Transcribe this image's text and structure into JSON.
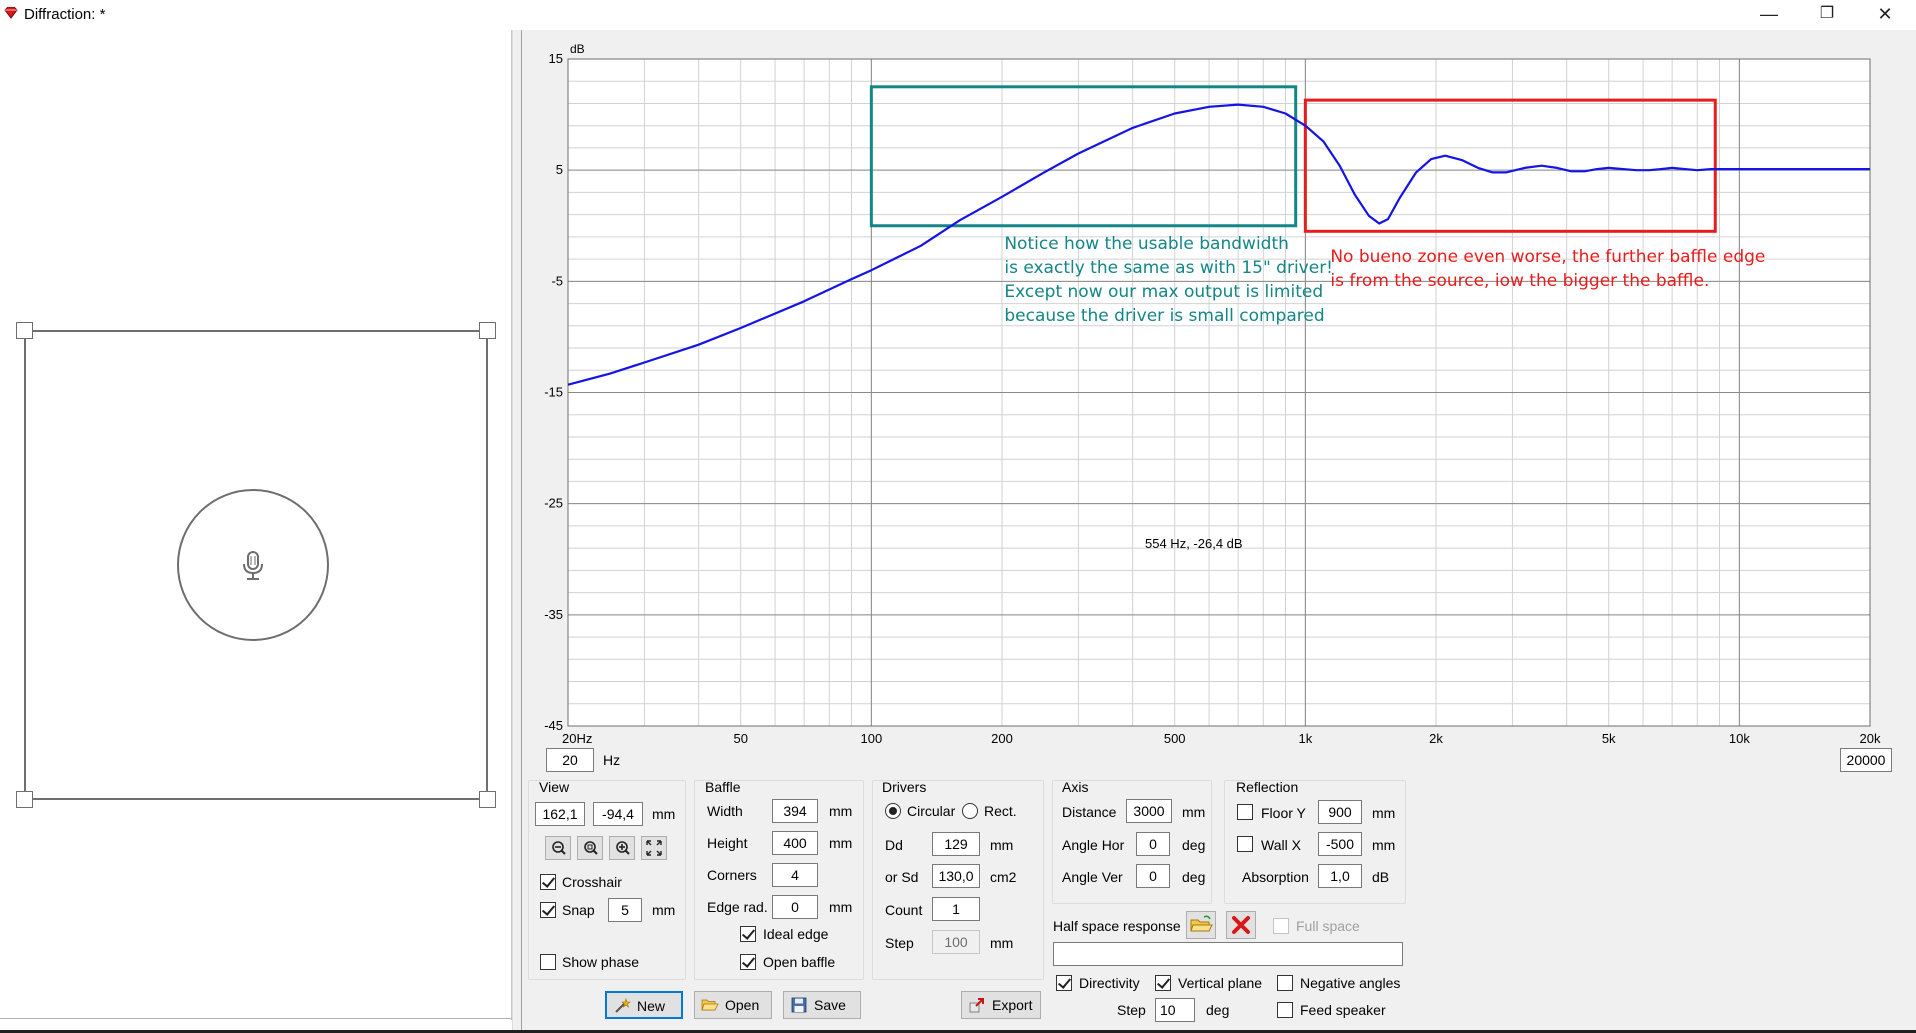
{
  "window": {
    "title": "Diffraction: *",
    "minimize_glyph": "—",
    "restore_glyph": "❐",
    "close_glyph": "✕"
  },
  "chart": {
    "freq_min_value": "20",
    "freq_min_unit": "Hz",
    "freq_max_value": "20000",
    "readout": "554 Hz, -26,4 dB"
  },
  "chart_data": {
    "type": "line",
    "xscale": "log",
    "xlim": [
      20,
      20000
    ],
    "ylim": [
      -45,
      15
    ],
    "ylabel": "dB",
    "grid": true,
    "y_ticks": [
      "15",
      "5",
      "-5",
      "-15",
      "-25",
      "-35",
      "-45"
    ],
    "x_ticks": [
      {
        "v": 20,
        "label": "20Hz"
      },
      {
        "v": 50,
        "label": "50"
      },
      {
        "v": 100,
        "label": "100"
      },
      {
        "v": 200,
        "label": "200"
      },
      {
        "v": 500,
        "label": "500"
      },
      {
        "v": 1000,
        "label": "1k"
      },
      {
        "v": 2000,
        "label": "2k"
      },
      {
        "v": 5000,
        "label": "5k"
      },
      {
        "v": 10000,
        "label": "10k"
      },
      {
        "v": 20000,
        "label": "20k"
      }
    ],
    "series": [
      {
        "color": "#1414e6",
        "points": [
          [
            20,
            -14.3
          ],
          [
            25,
            -13.3
          ],
          [
            30,
            -12.3
          ],
          [
            40,
            -10.7
          ],
          [
            50,
            -9.2
          ],
          [
            70,
            -6.8
          ],
          [
            90,
            -4.8
          ],
          [
            100,
            -4.0
          ],
          [
            130,
            -1.8
          ],
          [
            160,
            0.5
          ],
          [
            200,
            2.6
          ],
          [
            250,
            4.8
          ],
          [
            300,
            6.5
          ],
          [
            400,
            8.8
          ],
          [
            500,
            10.1
          ],
          [
            600,
            10.7
          ],
          [
            700,
            10.9
          ],
          [
            800,
            10.7
          ],
          [
            900,
            10.1
          ],
          [
            1000,
            9.0
          ],
          [
            1100,
            7.6
          ],
          [
            1200,
            5.4
          ],
          [
            1300,
            2.8
          ],
          [
            1400,
            0.9
          ],
          [
            1480,
            0.2
          ],
          [
            1550,
            0.6
          ],
          [
            1650,
            2.5
          ],
          [
            1800,
            4.8
          ],
          [
            1950,
            6.0
          ],
          [
            2100,
            6.3
          ],
          [
            2300,
            5.9
          ],
          [
            2500,
            5.2
          ],
          [
            2700,
            4.8
          ],
          [
            2900,
            4.8
          ],
          [
            3200,
            5.2
          ],
          [
            3500,
            5.4
          ],
          [
            3800,
            5.2
          ],
          [
            4100,
            4.9
          ],
          [
            4400,
            4.9
          ],
          [
            4700,
            5.1
          ],
          [
            5000,
            5.2
          ],
          [
            5400,
            5.1
          ],
          [
            5800,
            5.0
          ],
          [
            6200,
            5.0
          ],
          [
            6600,
            5.1
          ],
          [
            7000,
            5.2
          ],
          [
            7500,
            5.1
          ],
          [
            8000,
            5.0
          ],
          [
            8600,
            5.1
          ],
          [
            9200,
            5.1
          ],
          [
            10000,
            5.1
          ],
          [
            12000,
            5.1
          ],
          [
            15000,
            5.1
          ],
          [
            20000,
            5.1
          ]
        ]
      }
    ],
    "annotations": [
      {
        "color": "#138686",
        "box": {
          "x0": 100,
          "x1": 950,
          "y0": 0.0,
          "y1": 12.5
        },
        "text_lines": [
          "Notice how the usable bandwidth",
          "is exactly the same as with 15\" driver!",
          "Except now our max output is limited",
          "because the driver is small compared"
        ]
      },
      {
        "color": "#e81c1c",
        "box": {
          "x0": 1000,
          "x1": 8800,
          "y0": -0.5,
          "y1": 11.3
        },
        "text_lines": [
          "No bueno zone even worse, the further baffle edge",
          "is from the source, iow the bigger the baffle."
        ]
      }
    ]
  },
  "view": {
    "title": "View",
    "x_value": "162,1",
    "y_value": "-94,4",
    "unit": "mm",
    "crosshair_label": "Crosshair",
    "snap_label": "Snap",
    "snap_value": "5",
    "snap_unit": "mm",
    "show_phase_label": "Show phase"
  },
  "baffle": {
    "title": "Baffle",
    "width_label": "Width",
    "width_value": "394",
    "width_unit": "mm",
    "height_label": "Height",
    "height_value": "400",
    "height_unit": "mm",
    "corners_label": "Corners",
    "corners_value": "4",
    "edge_label": "Edge rad.",
    "edge_value": "0",
    "edge_unit": "mm",
    "ideal_edge_label": "Ideal edge",
    "open_baffle_label": "Open baffle"
  },
  "drivers": {
    "title": "Drivers",
    "circular_label": "Circular",
    "rect_label": "Rect.",
    "dd_label": "Dd",
    "dd_value": "129",
    "dd_unit": "mm",
    "sd_label": "or Sd",
    "sd_value": "130,0",
    "sd_unit": "cm2",
    "count_label": "Count",
    "count_value": "1",
    "step_label": "Step",
    "step_value": "100",
    "step_unit": "mm"
  },
  "axis": {
    "title": "Axis",
    "distance_label": "Distance",
    "distance_value": "3000",
    "distance_unit": "mm",
    "angle_hor_label": "Angle Hor",
    "angle_hor_value": "0",
    "angle_hor_unit": "deg",
    "angle_ver_label": "Angle Ver",
    "angle_ver_value": "0",
    "angle_ver_unit": "deg"
  },
  "reflection": {
    "title": "Reflection",
    "floor_label": "Floor Y",
    "floor_value": "900",
    "floor_unit": "mm",
    "wall_label": "Wall  X",
    "wall_value": "-500",
    "wall_unit": "mm",
    "absorption_label": "Absorption",
    "absorption_value": "1,0",
    "absorption_unit": "dB"
  },
  "half_space": {
    "label": "Half space response",
    "full_space_label": "Full space",
    "file_value": ""
  },
  "directivity": {
    "directivity_label": "Directivity",
    "vertical_plane_label": "Vertical plane",
    "negative_angles_label": "Negative angles",
    "step_label": "Step",
    "step_value": "10",
    "step_unit": "deg",
    "feed_speaker_label": "Feed speaker"
  },
  "buttons": {
    "new_label": "New",
    "open_label": "Open",
    "save_label": "Save",
    "export_label": "Export"
  }
}
